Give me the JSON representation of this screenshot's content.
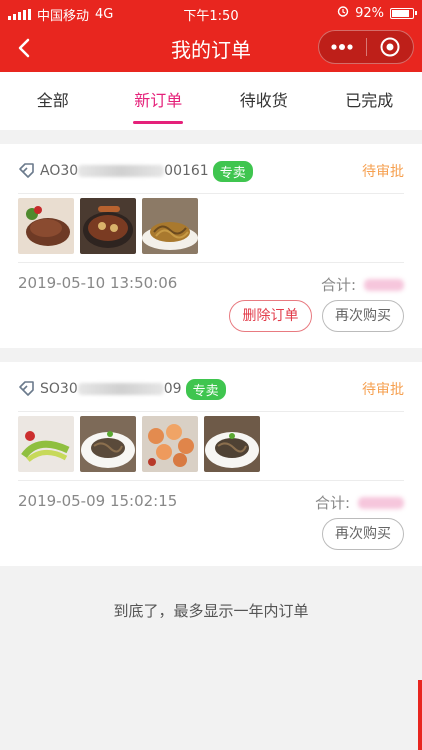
{
  "status_bar": {
    "carrier": "中国移动",
    "network": "4G",
    "time": "下午1:50",
    "battery": "92%",
    "battery_level": 0.92
  },
  "nav": {
    "title": "我的订单",
    "back_icon": "chevron-left-icon",
    "more_icon": "more-dots-icon",
    "close_icon": "target-circle-icon"
  },
  "tabs": [
    {
      "label": "全部",
      "active": false
    },
    {
      "label": "新订单",
      "active": true
    },
    {
      "label": "待收货",
      "active": false
    },
    {
      "label": "已完成",
      "active": false
    }
  ],
  "orders": [
    {
      "order_prefix": "AO30",
      "order_suffix": "00161",
      "badge": "专卖",
      "status": "待审批",
      "date": "2019-05-10 13:50:06",
      "total_label": "合计:",
      "images": [
        "steak",
        "braised-dish",
        "fried-noodles"
      ],
      "buttons": [
        "删除订单",
        "再次购买"
      ]
    },
    {
      "order_prefix": "SO30",
      "order_suffix": "09",
      "badge": "专卖",
      "status": "待审批",
      "date": "2019-05-09 15:02:15",
      "total_label": "合计:",
      "images": [
        "salad",
        "noodle-plate",
        "shrimp",
        "noodle-plate-2"
      ],
      "buttons": [
        "再次购买"
      ]
    }
  ],
  "footer_note": "到底了，最多显示一年内订单",
  "colors": {
    "brand_red": "#e8261f",
    "tab_active": "#e5217a",
    "status_orange": "#f6a050",
    "badge_green": "#3fc54f"
  }
}
